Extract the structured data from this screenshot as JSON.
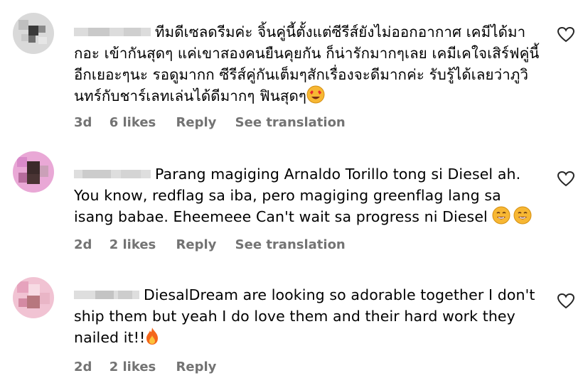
{
  "comments": [
    {
      "text": "ทีมดีเซลดรีมค่ะ จิ้นคู่นี้ตั้งแต่ซีรีส์ยังไม่ออกอากาศ เคมีได้มากอะ เข้ากันสุดๆ แค่เขาสองคนยืนคุยกัน ก็น่ารักมากๆเลย เคมีเคใจเสิร์ฟคู่นี้อีกเยอะๆนะ รอดูมากก ซีรีส์คู่กันเต็มๆสักเรื่องจะดีมากค่ะ รับรู้ได้เลยว่าภูวินทร์กับชาร์เลทเล่นได้ดีมากๆ ฟินสุดๆ",
      "time": "3d",
      "likes": "6 likes",
      "reply": "Reply",
      "translate": "See translation",
      "emoji": "heart-eyes-emoji"
    },
    {
      "text": "Parang magiging Arnaldo Torillo tong si Diesel ah. You know, redflag sa iba, pero magiging greenflag lang sa isang babae. Eheemeee Can't wait sa progress ni Diesel",
      "time": "2d",
      "likes": "2 likes",
      "reply": "Reply",
      "translate": "See translation",
      "emoji": "grinning-face-emoji"
    },
    {
      "text": "DiesalDream are looking so adorable together I don't ship them but yeah I do love them and their hard work they nailed it!!",
      "time": "2d",
      "likes": "2 likes",
      "reply": "Reply",
      "emoji": "fire-emoji"
    }
  ]
}
